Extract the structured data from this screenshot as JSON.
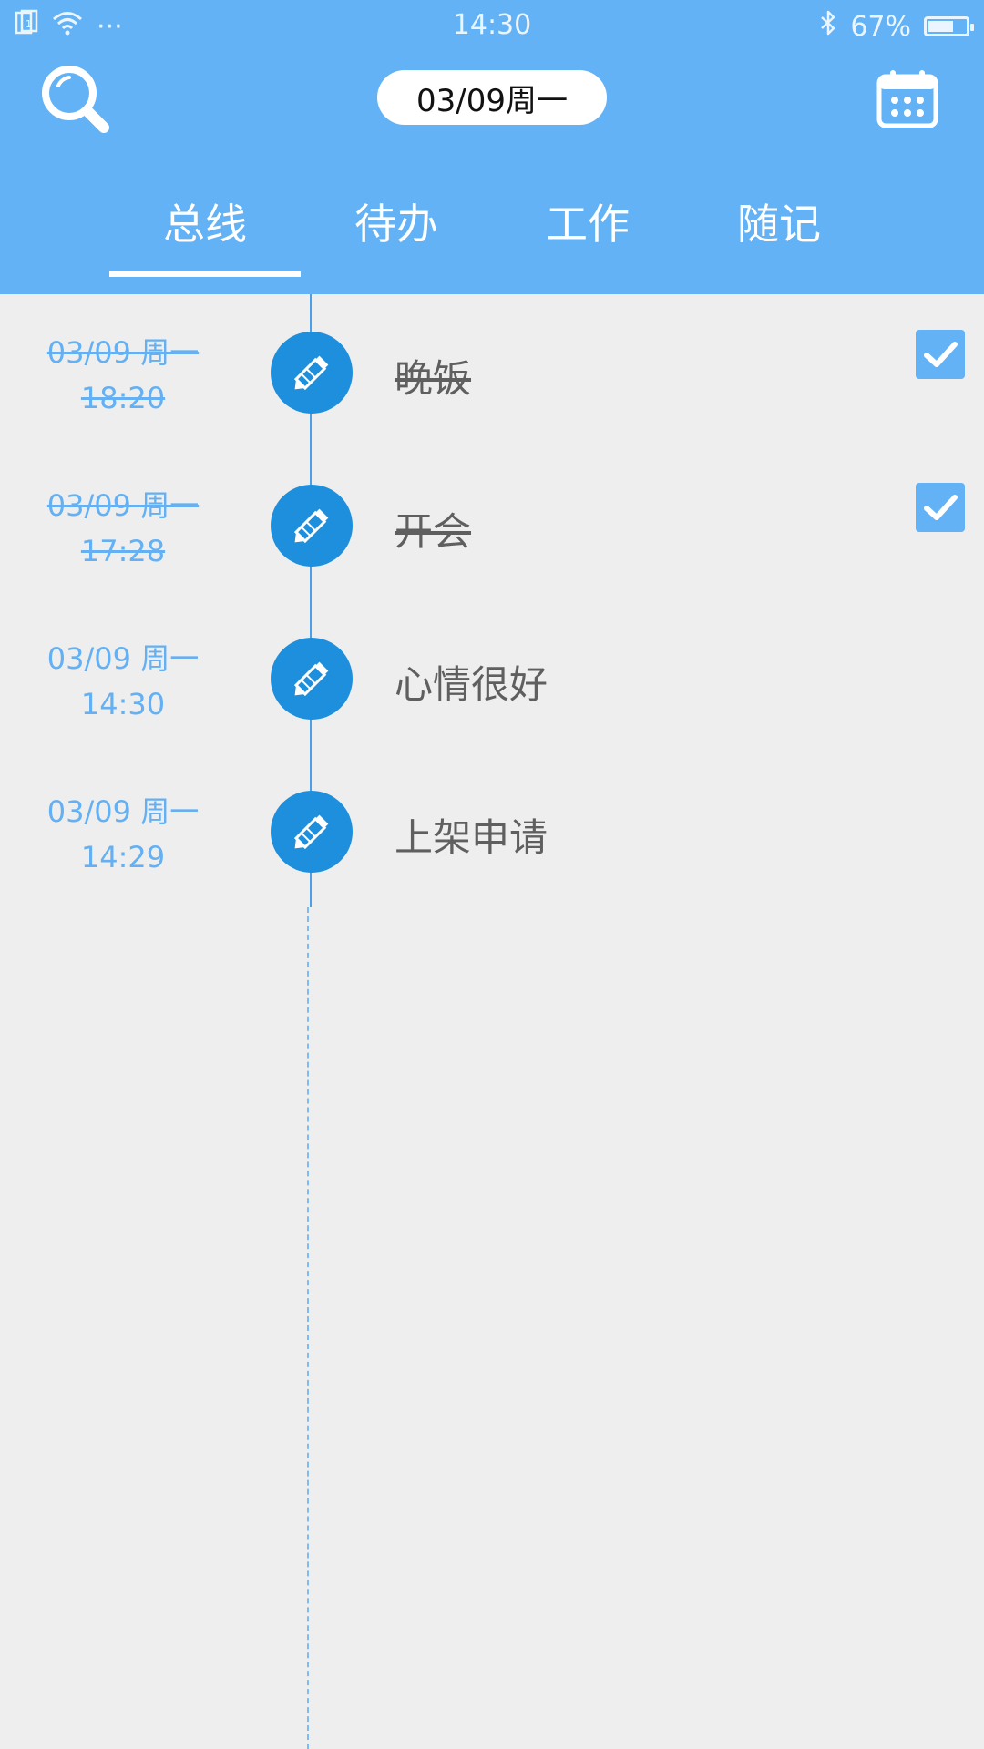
{
  "status_bar": {
    "time": "14:30",
    "battery_percent": "67%",
    "battery_level": 0.67,
    "overflow_dots": "···"
  },
  "header": {
    "date_pill": "03/09周一"
  },
  "tabs": [
    {
      "label": "总线",
      "selected": true
    },
    {
      "label": "待办",
      "selected": false
    },
    {
      "label": "工作",
      "selected": false
    },
    {
      "label": "随记",
      "selected": false
    }
  ],
  "items": [
    {
      "date": "03/09 周一",
      "time": "18:20",
      "title": "晚饭",
      "done": true,
      "icon": "pencil-icon"
    },
    {
      "date": "03/09 周一",
      "time": "17:28",
      "title": "开会",
      "done": true,
      "icon": "pencil-icon"
    },
    {
      "date": "03/09 周一",
      "time": "14:30",
      "title": "心情很好",
      "done": false,
      "icon": "pencil-icon"
    },
    {
      "date": "03/09 周一",
      "time": "14:29",
      "title": "上架申请",
      "done": false,
      "icon": "pencil-icon"
    }
  ],
  "colors": {
    "header_bg": "#63b2f5",
    "page_bg": "#eeeeee",
    "accent": "#1e8fdc",
    "date_text": "#64b0f2",
    "title_text": "#5f5f5f"
  }
}
